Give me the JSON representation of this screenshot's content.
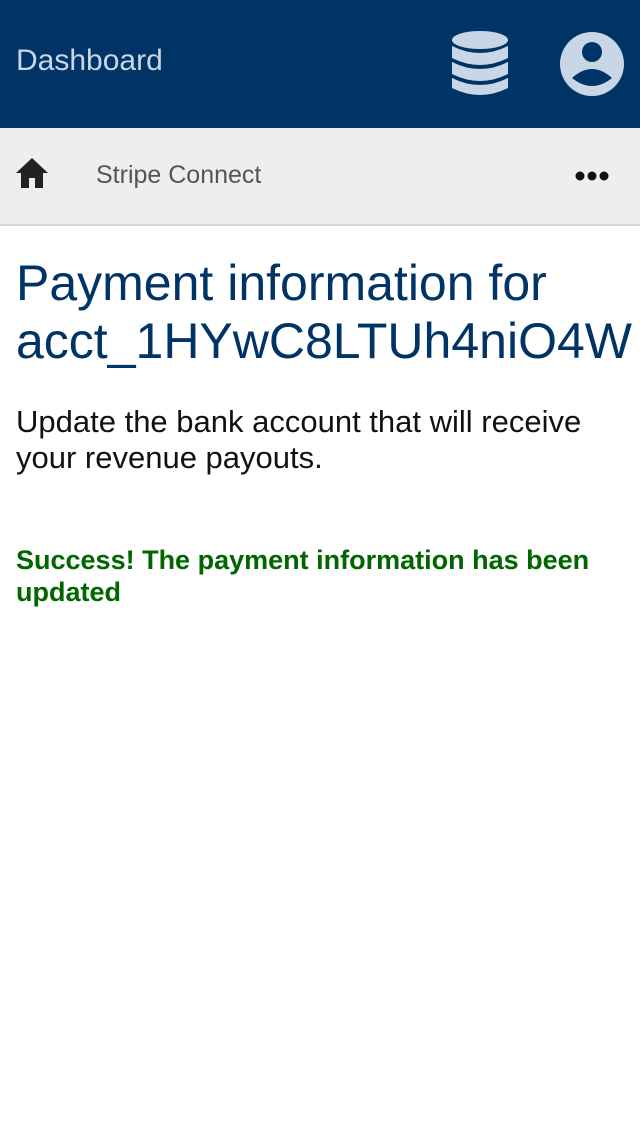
{
  "header": {
    "title": "Dashboard",
    "database_icon": "database-icon",
    "account_icon": "account-circle-icon"
  },
  "nav": {
    "home_icon": "home-icon",
    "breadcrumb": "Stripe Connect",
    "more_icon": "more-horizontal-icon"
  },
  "main": {
    "title_line1": "Payment information for",
    "title_line2": "acct_1HYwC8LTUh4niO4W",
    "subtitle": "Update the bank account that will receive your revenue payouts.",
    "success_message": "Success! The payment information has been updated"
  },
  "colors": {
    "header_bg": "#003366",
    "subbar_bg": "#eeeeee",
    "title": "#003366",
    "success": "#006600"
  }
}
